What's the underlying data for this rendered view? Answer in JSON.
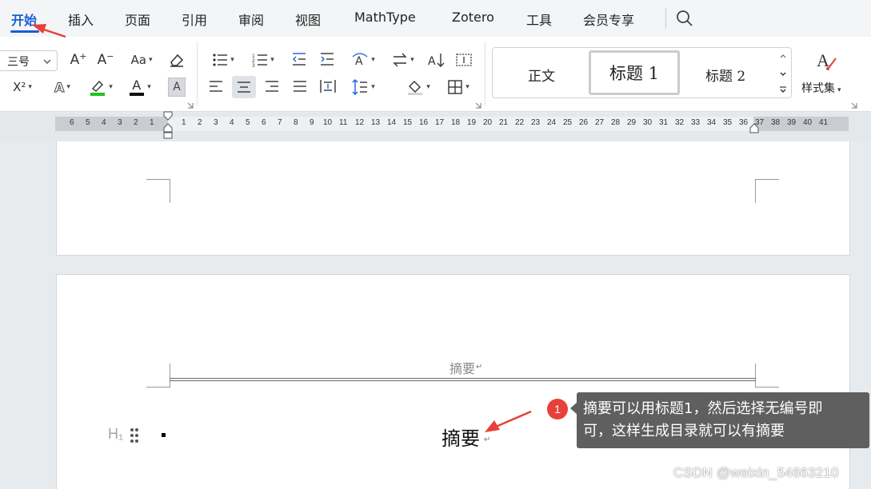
{
  "menu": {
    "tabs": [
      {
        "label": "开始",
        "active": true
      },
      {
        "label": "插入"
      },
      {
        "label": "页面"
      },
      {
        "label": "引用"
      },
      {
        "label": "审阅"
      },
      {
        "label": "视图"
      },
      {
        "label": "MathType"
      },
      {
        "label": "Zotero"
      },
      {
        "label": "工具"
      },
      {
        "label": "会员专享"
      }
    ],
    "search_icon": "search-icon"
  },
  "ribbon": {
    "font_size": "三号",
    "grow_font_label": "A",
    "shrink_font_label": "A",
    "change_case_label": "Aa",
    "superscript_label": "X²",
    "text_effect_label": "A",
    "highlight_color": "#22c222",
    "font_color_label": "A",
    "font_color": "#111111",
    "char_shading_label": "A",
    "styles": {
      "normal": "正文",
      "heading1": "标题 1",
      "heading2": "标题 2",
      "style_set": "样式集"
    }
  },
  "ruler": {
    "left_numbers": [
      "6",
      "5",
      "4",
      "3",
      "2",
      "1"
    ],
    "right_numbers": [
      "1",
      "2",
      "3",
      "4",
      "5",
      "6",
      "7",
      "8",
      "9",
      "10",
      "11",
      "12",
      "13",
      "14",
      "15",
      "16",
      "17",
      "18",
      "19",
      "20",
      "21",
      "22",
      "23",
      "24",
      "25",
      "26",
      "27",
      "28",
      "29",
      "30",
      "31",
      "32",
      "33",
      "34",
      "35",
      "36",
      "37",
      "38",
      "39",
      "40",
      "41"
    ]
  },
  "document": {
    "header_text": "摘要",
    "heading_marker": "H₁",
    "heading_text": "摘要"
  },
  "annotation": {
    "badge": "1",
    "line1": "摘要可以用标题1，然后选择无编号即",
    "line2": "可，这样生成目录就可以有摘要",
    "arrow_color": "#e8403a"
  },
  "watermark": "CSDN @weixin_54663210"
}
